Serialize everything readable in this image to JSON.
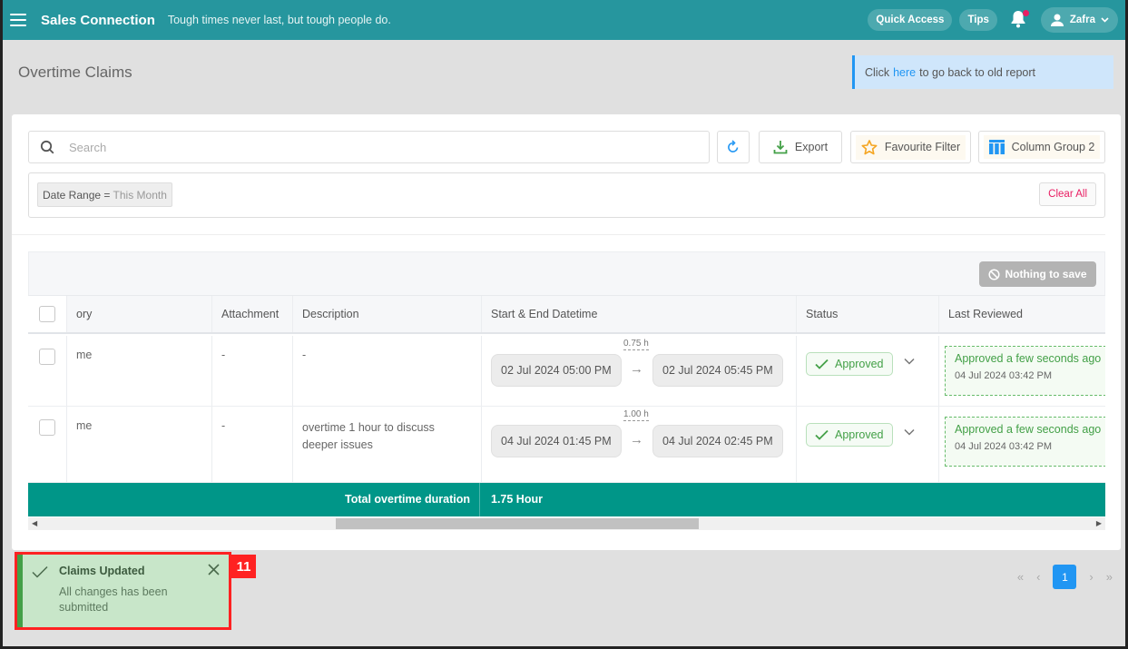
{
  "topbar": {
    "brand": "Sales Connection",
    "tagline": "Tough times never last, but tough people do.",
    "quick_access": "Quick Access",
    "tips": "Tips",
    "user_name": "Zafra",
    "brand_color": "#26969e",
    "notification_dot_color": "#e91e63"
  },
  "page": {
    "title": "Overtime Claims",
    "old_report": {
      "prefix": "Click",
      "link": "here",
      "suffix": "to go back to old report"
    }
  },
  "toolbar": {
    "search_placeholder": "Search",
    "export_label": "Export",
    "favourite_filter_label": "Favourite Filter",
    "column_group_label": "Column Group 2"
  },
  "filters": {
    "chips": [
      {
        "field": "Date Range",
        "operator": "=",
        "value": "This Month"
      }
    ],
    "clear_all": "Clear All"
  },
  "table": {
    "save_button": "Nothing to save",
    "columns": [
      "ory",
      "Attachment",
      "Description",
      "Start & End Datetime",
      "Status",
      "Last Reviewed"
    ],
    "rows": [
      {
        "category": "me",
        "attachment": "-",
        "description": "-",
        "start": "02 Jul 2024 05:00 PM",
        "end": "02 Jul 2024 05:45 PM",
        "duration": "0.75 h",
        "status": "Approved",
        "reviewed_text": "Approved a few seconds ago",
        "reviewed_time": "04 Jul 2024 03:42 PM"
      },
      {
        "category": "me",
        "attachment": "-",
        "description": "overtime 1 hour to discuss deeper issues",
        "start": "04 Jul 2024 01:45 PM",
        "end": "04 Jul 2024 02:45 PM",
        "duration": "1.00 h",
        "status": "Approved",
        "reviewed_text": "Approved a few seconds ago",
        "reviewed_time": "04 Jul 2024 03:42 PM"
      }
    ],
    "footer": {
      "label": "Total overtime duration",
      "value": "1.75 Hour"
    },
    "footer_color": "#009688"
  },
  "pagination": {
    "first": "«",
    "prev": "‹",
    "current": "1",
    "next": "›",
    "last": "»"
  },
  "toast": {
    "title": "Claims Updated",
    "message": "All changes has been submitted",
    "annotation_number": "11"
  }
}
